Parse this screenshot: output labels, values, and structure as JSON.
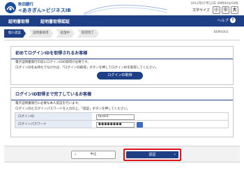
{
  "header": {
    "bank_name": "秋田銀行",
    "service_name": "<あきぎん>ビジネスIB",
    "datetime": "2012年07月12日 09時00分00秒",
    "fontsize_label": "文字サイズ",
    "fontsize_options": [
      "小",
      "中",
      "大"
    ],
    "fontsize_selected": "大"
  },
  "titlebar": {
    "left_label": "証明書取得",
    "center_label": "証明書取得認証",
    "help_label": "ヘルプ"
  },
  "steps": [
    "個人認証",
    "証明書取得",
    "処理中",
    "取得完了"
  ],
  "screen_id": "BSMS001",
  "first_login": {
    "title": "初めてログインIDを取得されるお客様",
    "text1": "電子証明書発行の前にログインIDの取得が必要です。",
    "text2": "ログインIDをお持ちでなければ、「ログインID取得」ボタンを押してログインIDを取得してください。",
    "button_label": "ログインID取得"
  },
  "existing_login": {
    "title": "ログインID取得まで完了しているお客様",
    "text1": "電子証明書発行に必要な本人認証を行います。",
    "text2": "ログインIDとログインパスワードを入力の上、「認証」ボタンを押してください。",
    "fields": {
      "login_id_label": "ログインID",
      "login_id_value": "taro01",
      "password_label": "ログインパスワード",
      "password_value": "●●●●●●●●"
    }
  },
  "actions": {
    "back_label": "中止",
    "auth_label": "認証"
  },
  "colors": {
    "navy": "#1e3f86",
    "highlight": "#e0141c"
  }
}
